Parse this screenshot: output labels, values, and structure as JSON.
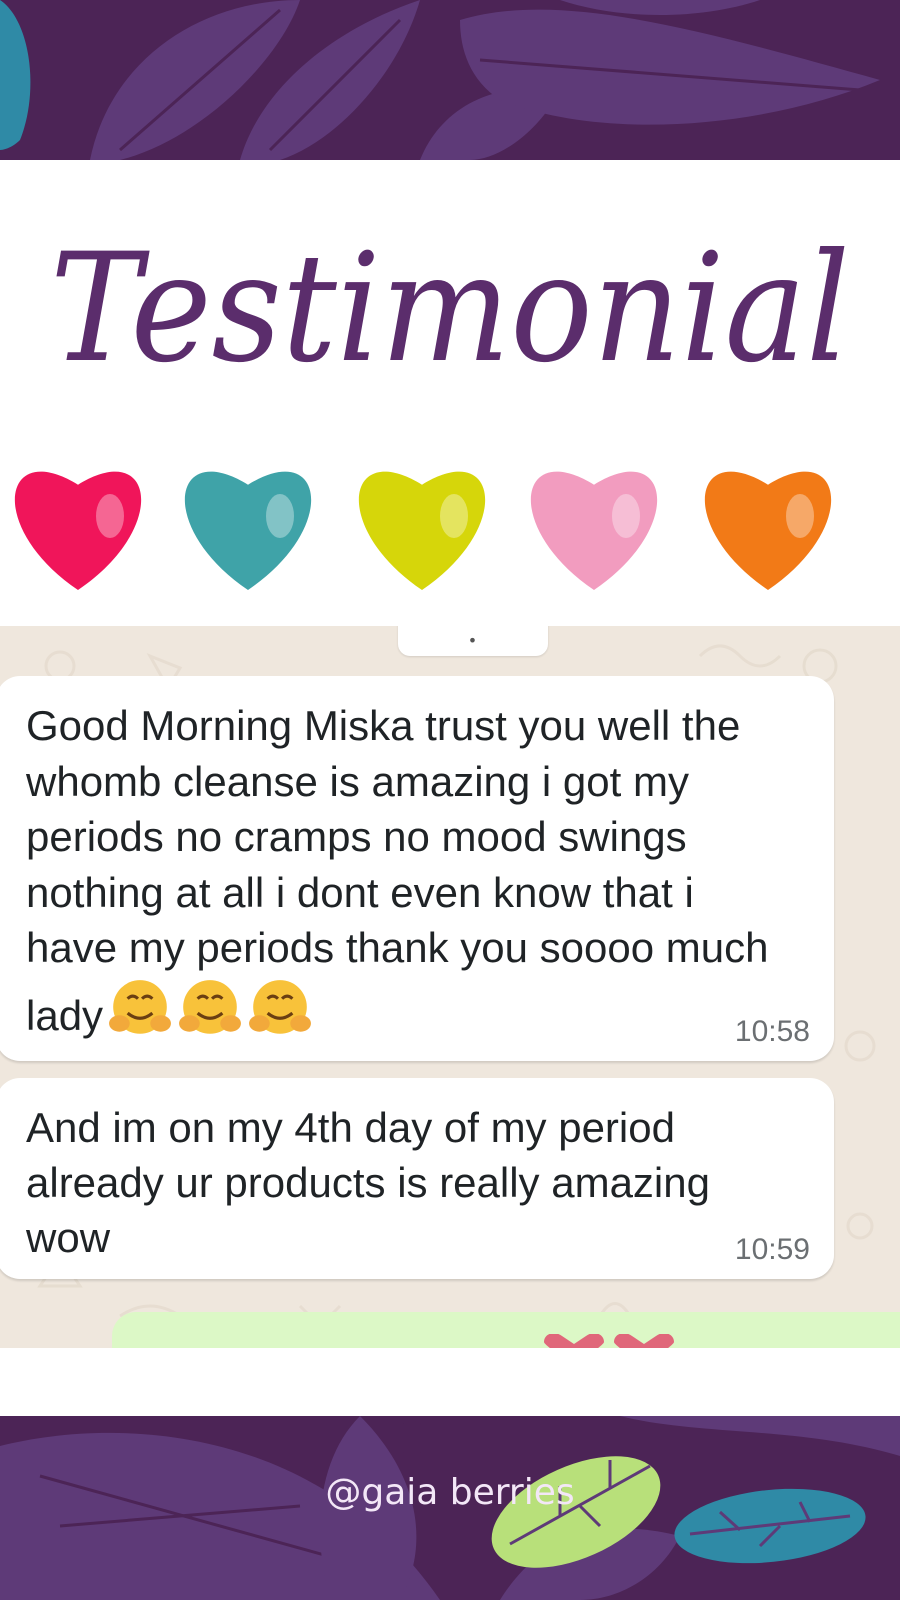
{
  "header": {
    "title": "Testimonial",
    "heart_colors": [
      "#f0155a",
      "#3fa3a8",
      "#d6d60a",
      "#f29cbf",
      "#f27a17"
    ]
  },
  "chat": {
    "messages": [
      {
        "text": "Good Morning Miska trust you well the whomb cleanse is amazing i got my periods no cramps no mood swings nothing at all i dont even know that i have my periods thank you soooo much lady",
        "emoji": [
          "hugging-face-icon",
          "hugging-face-icon",
          "hugging-face-icon"
        ],
        "time": "10:58"
      },
      {
        "text": "And im on my 4th day of my period already ur products is really amazing wow",
        "time": "10:59"
      }
    ],
    "outgoing_preview": {
      "icons": [
        "heart-icon",
        "heart-icon"
      ]
    }
  },
  "footer": {
    "handle": "@gaia berries"
  },
  "colors": {
    "purple_band": "#4c2456",
    "leaf_purple": "#5e3a78",
    "title_purple": "#5b2d6c",
    "chat_bg": "#efe7dd",
    "outgoing_bubble": "#dcf8c6",
    "leaf_green": "#b8e07a",
    "leaf_blue": "#2f8aa6"
  }
}
